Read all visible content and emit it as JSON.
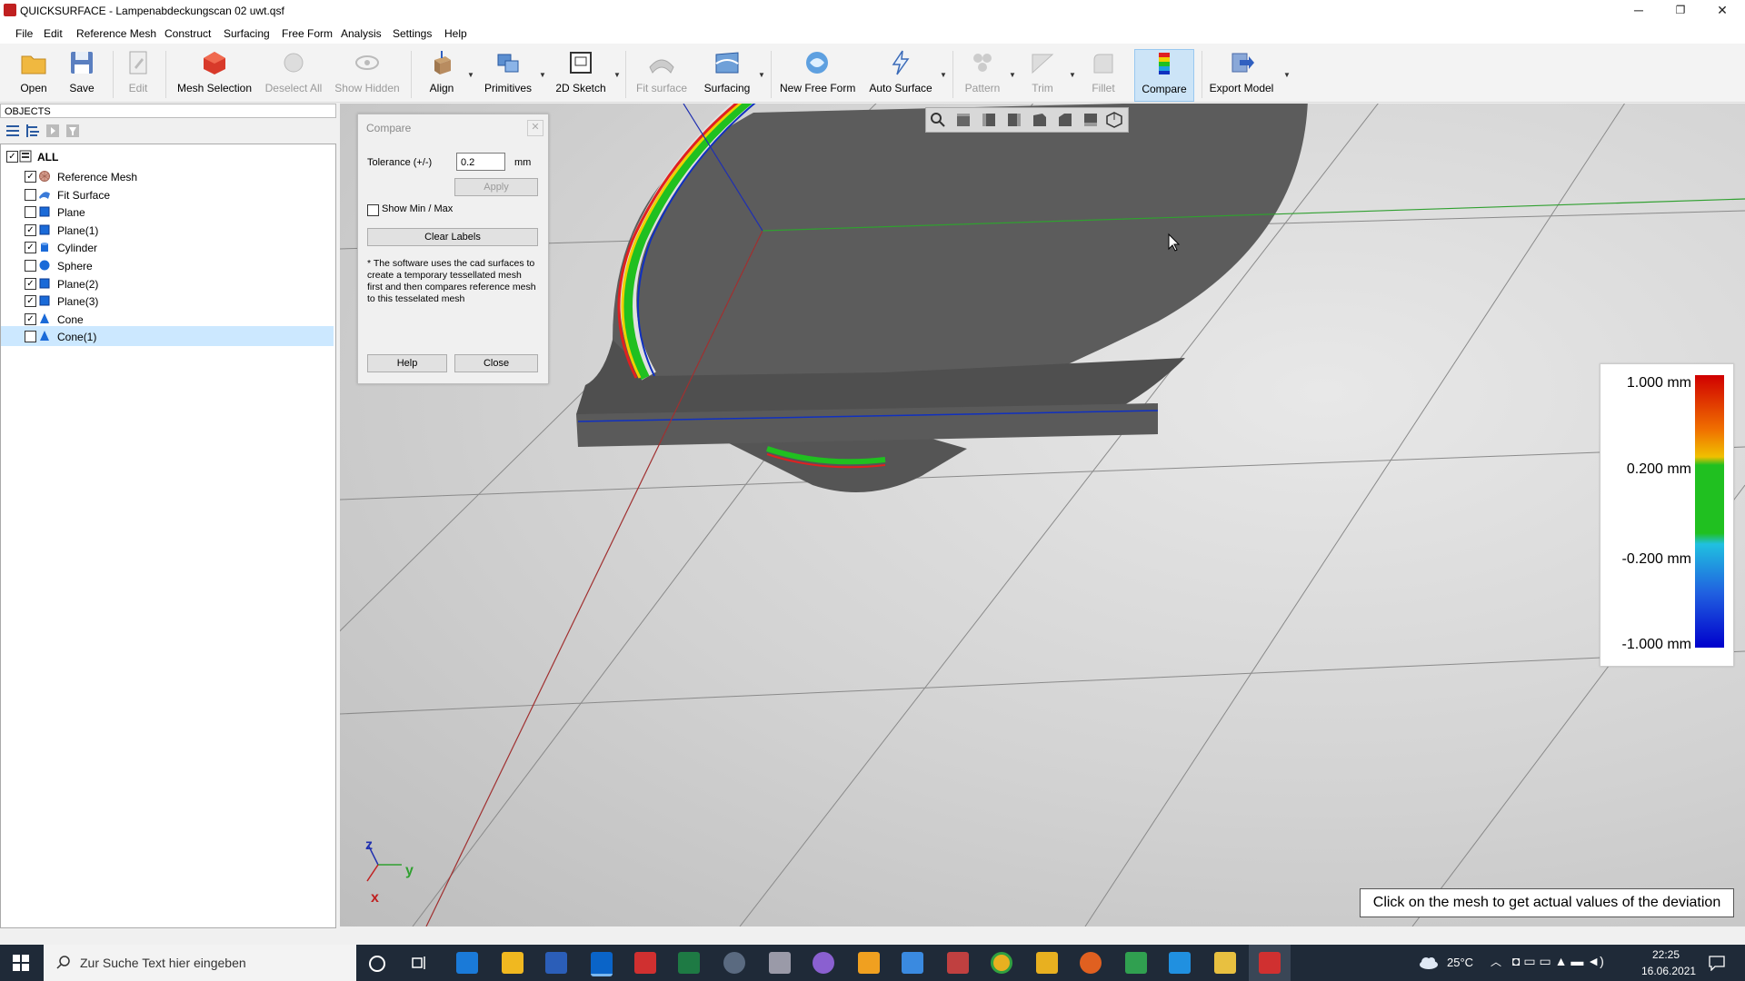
{
  "window": {
    "title": "QUICKSURFACE - Lampenabdeckungscan 02 uwt.qsf",
    "minimize": "─",
    "restore": "❐",
    "close": "✕"
  },
  "menu": [
    "File",
    "Edit",
    "Reference Mesh",
    "Construct",
    "Surfacing",
    "Free Form",
    "Analysis",
    "Settings",
    "Help"
  ],
  "toolbar": {
    "open": "Open",
    "save": "Save",
    "edit": "Edit",
    "mesh_selection": "Mesh Selection",
    "deselect_all": "Deselect All",
    "show_hidden": "Show Hidden",
    "align": "Align",
    "primitives": "Primitives",
    "sketch2d": "2D Sketch",
    "fit_surface": "Fit surface",
    "surfacing": "Surfacing",
    "new_free_form": "New Free Form",
    "auto_surface": "Auto Surface",
    "pattern": "Pattern",
    "trim": "Trim",
    "fillet": "Fillet",
    "compare": "Compare",
    "export_model": "Export Model"
  },
  "objects": {
    "header": "OBJECTS",
    "root": "ALL",
    "items": [
      {
        "label": "Reference Mesh",
        "checked": true,
        "icon": "mesh-icon"
      },
      {
        "label": "Fit Surface",
        "checked": false,
        "icon": "surface-icon"
      },
      {
        "label": "Plane",
        "checked": false,
        "icon": "plane-icon"
      },
      {
        "label": "Plane(1)",
        "checked": true,
        "icon": "plane-icon"
      },
      {
        "label": "Cylinder",
        "checked": true,
        "icon": "cylinder-icon"
      },
      {
        "label": "Sphere",
        "checked": false,
        "icon": "sphere-icon"
      },
      {
        "label": "Plane(2)",
        "checked": true,
        "icon": "plane-icon"
      },
      {
        "label": "Plane(3)",
        "checked": true,
        "icon": "plane-icon"
      },
      {
        "label": "Cone",
        "checked": true,
        "icon": "cone-icon"
      },
      {
        "label": "Cone(1)",
        "checked": false,
        "icon": "cone-icon",
        "selected": true
      }
    ]
  },
  "compare_dialog": {
    "title": "Compare",
    "tolerance_label": "Tolerance (+/-)",
    "tolerance_value": "0.2",
    "unit": "mm",
    "apply": "Apply",
    "show_min_max": "Show Min / Max",
    "clear_labels": "Clear Labels",
    "note": "* The software uses the cad surfaces to create a temporary tessellated mesh first and then compares reference mesh to this tesselated mesh",
    "help": "Help",
    "close": "Close"
  },
  "legend": {
    "max": "1.000 mm",
    "upper": "0.200 mm",
    "lower": "-0.200 mm",
    "min": "-1.000 mm"
  },
  "hint": "Click on the mesh to get actual values of the deviation",
  "axes": {
    "z": "z",
    "y": "y",
    "x": "x"
  },
  "taskbar": {
    "search_placeholder": "Zur Suche Text hier eingeben",
    "temperature": "25°C",
    "time": "22:25",
    "date": "16.06.2021"
  },
  "colors": {
    "accent": "#0078d7",
    "legend_red": "#d00000",
    "legend_green": "#00cc00",
    "legend_blue": "#0000cc"
  }
}
